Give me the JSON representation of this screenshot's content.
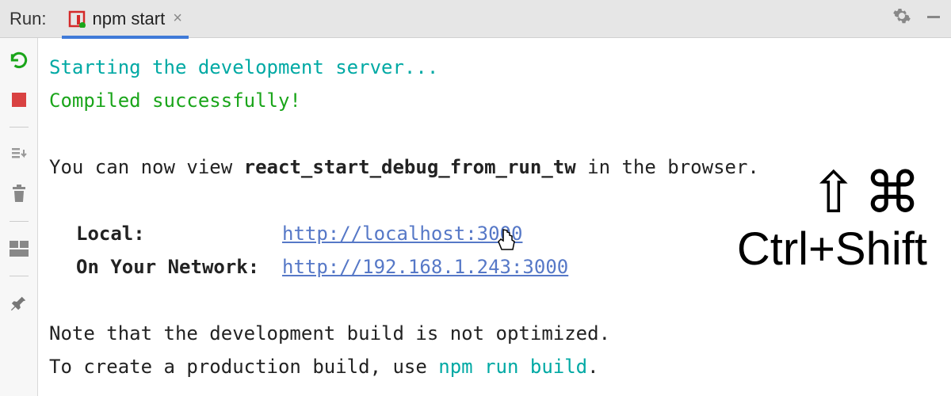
{
  "header": {
    "run_label": "Run:",
    "tab_name": "npm start"
  },
  "console": {
    "starting": "Starting the development server...",
    "compiled": "Compiled successfully!",
    "view_prefix": "You can now view ",
    "view_project": "react_start_debug_from_run_tw",
    "view_suffix": " in the browser.",
    "local_label": "Local:",
    "local_url": "http://localhost:3000",
    "network_label": "On Your Network:",
    "network_url": "http://192.168.1.243:3000",
    "note1": "Note that the development build is not optimized.",
    "note2_prefix": "To create a production build, use ",
    "note2_cmd": "npm run build",
    "note2_suffix": "."
  },
  "shortcut": {
    "symbols": "⇧⌘",
    "text": "Ctrl+Shift"
  }
}
